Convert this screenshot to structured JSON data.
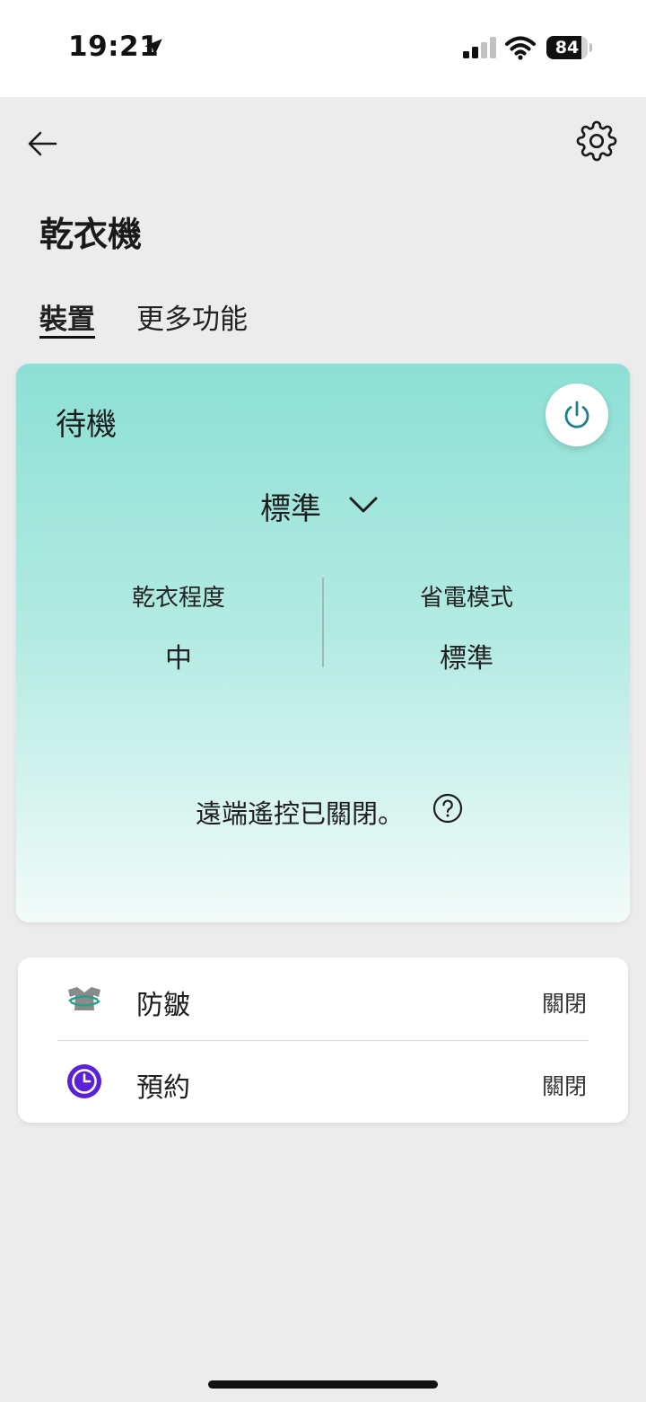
{
  "status_bar": {
    "time": "19:21",
    "battery": "84",
    "battery_level": 0.84,
    "icons": [
      "location-arrow-icon",
      "cellular-signal-icon",
      "wifi-icon",
      "battery-icon"
    ]
  },
  "header": {
    "back_icon": "arrow-left-icon",
    "settings_icon": "gear-icon",
    "title": "乾衣機"
  },
  "tabs": [
    {
      "label": "裝置",
      "active": true
    },
    {
      "label": "更多功能",
      "active": false
    }
  ],
  "status_card": {
    "state": "待機",
    "mode": "標準",
    "power_icon": "power-icon",
    "chevron_icon": "chevron-down-icon",
    "specs": [
      {
        "label": "乾衣程度",
        "value": "中"
      },
      {
        "label": "省電模式",
        "value": "標準"
      }
    ],
    "remote_text": "遠端遙控已關閉。",
    "help_icon": "question-circle-icon"
  },
  "options": [
    {
      "label": "防皺",
      "value": "關閉",
      "icon": "anti-wrinkle-icon"
    },
    {
      "label": "預約",
      "value": "關閉",
      "icon": "timer-clock-icon"
    }
  ],
  "colors": {
    "accent_teal": "#1b7f8e",
    "card_gradient_top": "#8de0d5",
    "card_gradient_bottom": "#f2fbf9",
    "schedule_purple": "#5b21d6"
  }
}
